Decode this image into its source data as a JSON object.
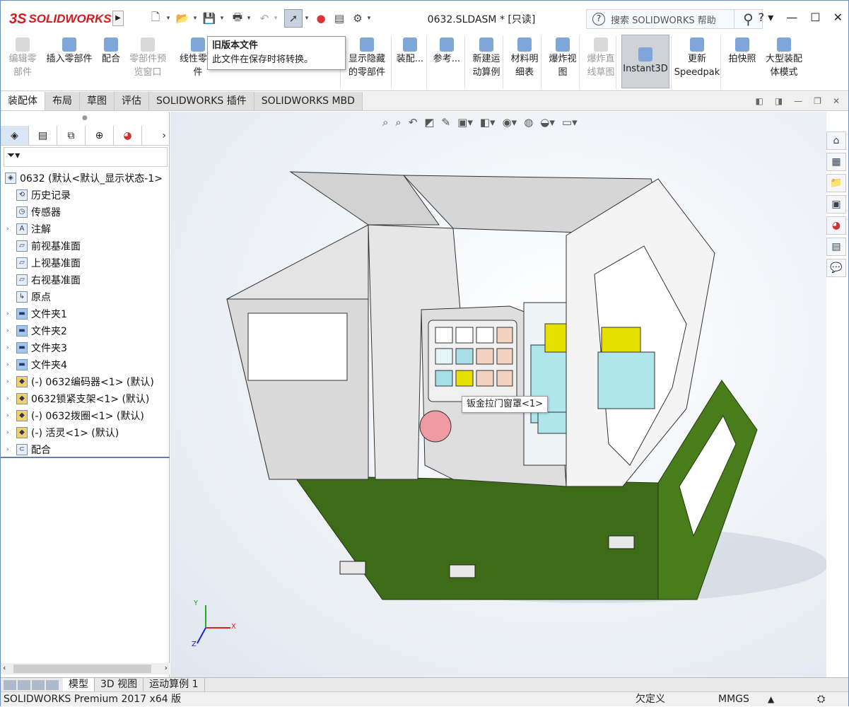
{
  "app": {
    "logo": "SOLIDWORKS",
    "document_title": "0632.SLDASM * [只读]"
  },
  "search": {
    "placeholder": "搜索 SOLIDWORKS 帮助"
  },
  "tooltip": {
    "title": "旧版本文件",
    "body": "此文件在保存时将转换。"
  },
  "ribbon": {
    "items": [
      {
        "label": "编辑零\n部件",
        "disabled": true
      },
      {
        "label": "插入零部件",
        "disabled": false
      },
      {
        "label": "配合",
        "disabled": false
      },
      {
        "label": "零部件预\n览窗口",
        "disabled": true
      },
      {
        "label": "线性零部\n件",
        "disabled": false
      },
      {
        "label": "显示隐藏\n的零部件",
        "disabled": false
      },
      {
        "label": "装配...",
        "disabled": false
      },
      {
        "label": "参考...",
        "disabled": false
      },
      {
        "label": "新建运\n动算例",
        "disabled": false
      },
      {
        "label": "材料明\n细表",
        "disabled": false
      },
      {
        "label": "爆炸视\n图",
        "disabled": false
      },
      {
        "label": "爆炸直\n线草图",
        "disabled": true
      },
      {
        "label": "Instant3D",
        "disabled": false,
        "selected": true
      },
      {
        "label": "更新\nSpeedpak",
        "disabled": false
      },
      {
        "label": "拍快照",
        "disabled": false
      },
      {
        "label": "大型装配\n体模式",
        "disabled": false
      }
    ]
  },
  "tabs": [
    "装配体",
    "布局",
    "草图",
    "评估",
    "SOLIDWORKS 插件",
    "SOLIDWORKS MBD"
  ],
  "tree": {
    "root": "0632 (默认<默认_显示状态-1>",
    "items": [
      {
        "label": "历史记录",
        "expandable": false
      },
      {
        "label": "传感器",
        "expandable": false
      },
      {
        "label": "注解",
        "expandable": true
      },
      {
        "label": "前视基准面",
        "expandable": false
      },
      {
        "label": "上视基准面",
        "expandable": false
      },
      {
        "label": "右视基准面",
        "expandable": false
      },
      {
        "label": "原点",
        "expandable": false
      },
      {
        "label": "文件夹1",
        "expandable": true
      },
      {
        "label": "文件夹2",
        "expandable": true
      },
      {
        "label": "文件夹3",
        "expandable": true
      },
      {
        "label": "文件夹4",
        "expandable": true
      },
      {
        "label": "(-) 0632编码器<1> (默认)",
        "expandable": true
      },
      {
        "label": "0632锁紧支架<1> (默认)",
        "expandable": true
      },
      {
        "label": "(-) 0632拨圈<1> (默认)",
        "expandable": true
      },
      {
        "label": "(-) 活灵<1> (默认)",
        "expandable": true
      },
      {
        "label": "配合",
        "expandable": true
      }
    ]
  },
  "callout": "钣金拉门窗罩<1>",
  "axes": {
    "x": "X",
    "y": "Y",
    "z": "Z"
  },
  "bottom_tabs": [
    "模型",
    "3D 视图",
    "运动算例 1"
  ],
  "status": {
    "product": "SOLIDWORKS Premium 2017 x64 版",
    "state": "欠定义",
    "units": "MMGS"
  }
}
